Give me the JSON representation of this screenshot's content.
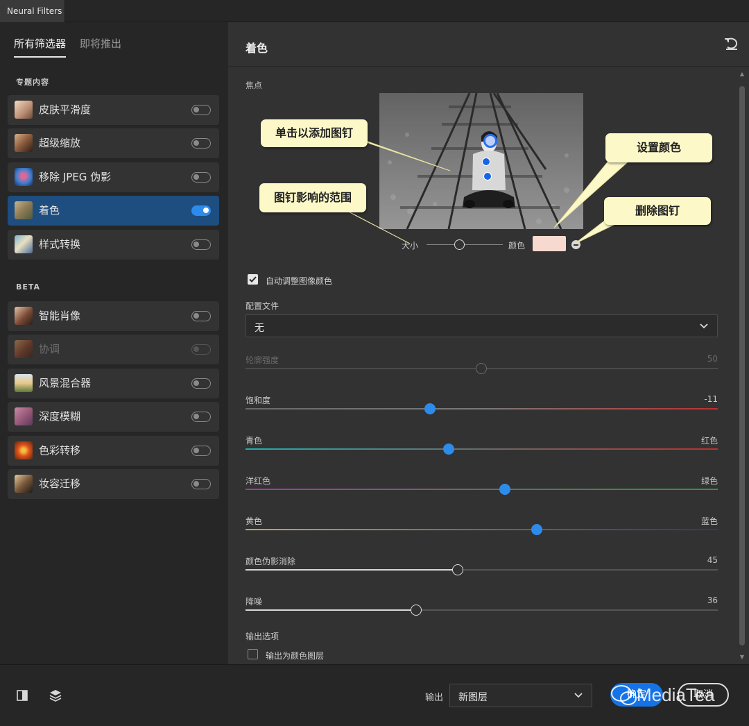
{
  "window": {
    "title": "Neural Filters"
  },
  "sidebar": {
    "tabs": [
      {
        "label": "所有筛选器",
        "active": true
      },
      {
        "label": "即将推出",
        "active": false
      }
    ],
    "featured_label": "专题内容",
    "beta_label": "BETA",
    "featured": [
      {
        "label": "皮肤平滑度",
        "on": false
      },
      {
        "label": "超级缩放",
        "on": false
      },
      {
        "label": "移除 JPEG 伪影",
        "on": false
      },
      {
        "label": "着色",
        "on": true,
        "selected": true
      },
      {
        "label": "样式转换",
        "on": false
      }
    ],
    "beta": [
      {
        "label": "智能肖像",
        "on": false
      },
      {
        "label": "协调",
        "on": false,
        "disabled": true
      },
      {
        "label": "风景混合器",
        "on": false
      },
      {
        "label": "深度模糊",
        "on": false
      },
      {
        "label": "色彩转移",
        "on": false
      },
      {
        "label": "妆容迁移",
        "on": false
      }
    ]
  },
  "main": {
    "title": "着色",
    "focus_label": "焦点",
    "callouts": {
      "add_pin": "单击以添加图钉",
      "pin_range": "图钉影响的范围",
      "set_color": "设置颜色",
      "remove_pin": "删除图钉"
    },
    "size_label": "大小",
    "size_value": 0.5,
    "color_label": "颜色",
    "pin_color": "#f8d9d0",
    "auto_adjust": {
      "label": "自动调整图像颜色",
      "checked": true
    },
    "profile": {
      "label": "配置文件",
      "value": "无"
    },
    "sliders": {
      "contour": {
        "label": "轮廓强度",
        "value": "50",
        "position": 0.5,
        "disabled": true
      },
      "saturation": {
        "label": "饱和度",
        "value": "-11",
        "position": 0.39
      },
      "cyan_red": {
        "left": "青色",
        "right": "红色",
        "position": 0.43
      },
      "magenta_green": {
        "left": "洋红色",
        "right": "绿色",
        "position": 0.55
      },
      "yellow_blue": {
        "left": "黄色",
        "right": "蓝色",
        "position": 0.617
      },
      "artifact": {
        "label": "颜色伪影消除",
        "value": "45",
        "position": 0.45
      },
      "noise": {
        "label": "降噪",
        "value": "36",
        "position": 0.36
      }
    },
    "output_options": {
      "label": "输出选项",
      "as_color_layer": {
        "label": "输出为颜色图层",
        "checked": false
      }
    }
  },
  "footer": {
    "output_label": "输出",
    "output_value": "新图层",
    "ok_label": "确定",
    "cancel_label": "取消",
    "watermark": "MediaTea"
  },
  "colors": {
    "accent": "#2d8ceb",
    "selected_row": "#1e4d7f",
    "callout": "#fcf8c8"
  }
}
